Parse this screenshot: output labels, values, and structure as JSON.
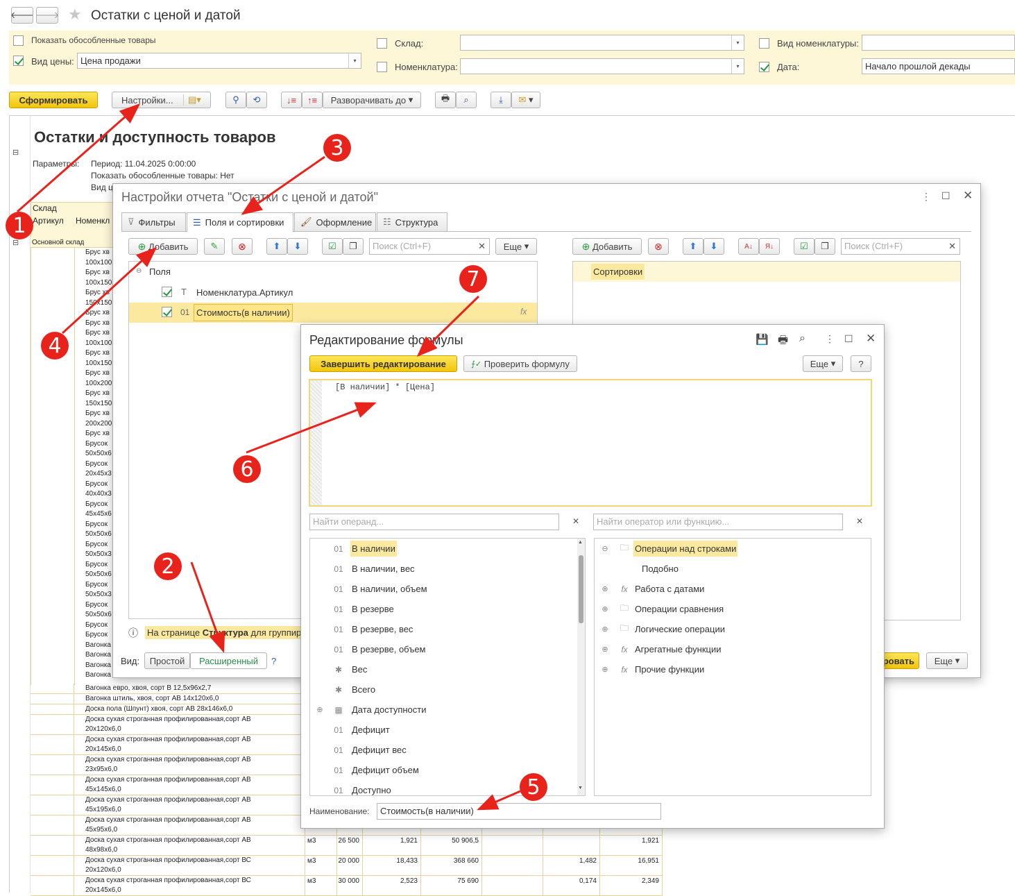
{
  "header": {
    "title": "Остатки с ценой и датой"
  },
  "params": {
    "show_separate": "Показать обособленные товары",
    "price_type_label": "Вид цены:",
    "price_type_value": "Цена продажи",
    "warehouse_label": "Склад:",
    "nomenclature_label": "Номенклатура:",
    "nom_kind_label": "Вид номенклатуры:",
    "date_label": "Дата:",
    "date_value": "Начало прошлой декады"
  },
  "toolbar": {
    "generate": "Сформировать",
    "settings": "Настройки...",
    "expand_to": "Разворачивать до"
  },
  "report": {
    "title": "Остатки и доступность товаров",
    "params_label": "Параметры:",
    "period": "Период: 11.04.2025 0:00:00",
    "show_separate": "Показать обособленные товары: Нет",
    "view_partial": "Вид ц",
    "col_warehouse": "Склад",
    "col_article": "Артикул",
    "col_nom_partial": "Номенкл",
    "group_row": "Основной склад",
    "rows_partial": [
      "Брус хв",
      "100х100",
      "Брус хв",
      "100х150",
      "Брус хв",
      "150х150",
      "Брус хв",
      "Брус хв",
      "Брус хв",
      "100х100",
      "Брус хв",
      "100х150",
      "Брус хв",
      "100х200",
      "Брус хв",
      "150х150",
      "Брус хв",
      "200х200",
      "Брус хв",
      "Брусок",
      "50х50х6",
      "Брусок",
      "20х45х3",
      "Брусок",
      "40х40х3",
      "Брусок",
      "45х45х6",
      "Брусок",
      "50х50х6",
      "Брусок",
      "50х50х3",
      "Брусок",
      "50х50х6",
      "Брусок",
      "50х50х3",
      "Брусок",
      "50х50х6",
      "Брусок",
      "Брусок",
      "Вагонка",
      "Вагонка",
      "Вагонка",
      "Вагонка"
    ],
    "rows": [
      {
        "name": "Вагонка евро, хвоя, сорт В 12,5х96х2,7"
      },
      {
        "name": "Вагонка штиль, хвоя, сорт АВ 14х120х6,0"
      },
      {
        "name": "Доска пола (Шпунт) хвоя, сорт АВ 28х146х6,0"
      },
      {
        "name": "Доска сухая строганная профилированная,сорт АВ",
        "sub": "20х120х6,0"
      },
      {
        "name": "Доска сухая строганная профилированная,сорт АВ",
        "sub": "20х145х6,0"
      },
      {
        "name": "Доска сухая строганная профилированная,сорт АВ",
        "sub": "23х95х6,0"
      },
      {
        "name": "Доска сухая строганная профилированная,сорт АВ",
        "sub": "45х145х6,0"
      },
      {
        "name": "Доска сухая строганная профилированная,сорт АВ",
        "sub": "45х195х6,0"
      },
      {
        "name": "Доска сухая строганная профилированная,сорт АВ",
        "sub": "45х95х6,0"
      },
      {
        "name": "Доска сухая строганная профилированная,сорт АВ",
        "sub": "48х98х6,0",
        "unit": "м3",
        "c1": "26 500",
        "c2": "1,921",
        "c3": "50 906,5",
        "c4": "",
        "c5": "",
        "c6": "1,921"
      },
      {
        "name": "Доска сухая строганная профилированная,сорт ВС",
        "sub": "20х120х6,0",
        "unit": "м3",
        "c1": "20 000",
        "c2": "18,433",
        "c3": "368 660",
        "c4": "",
        "c5": "1,482",
        "c6": "16,951"
      },
      {
        "name": "Доска сухая строганная профилированная,сорт ВС",
        "sub": "20х145х6,0",
        "unit": "м3",
        "c1": "30 000",
        "c2": "2,523",
        "c3": "75 690",
        "c4": "",
        "c5": "0,174",
        "c6": "2,349"
      }
    ]
  },
  "settings": {
    "title": "Настройки отчета \"Остатки с ценой и датой\"",
    "tabs": [
      "Фильтры",
      "Поля и сортировки",
      "Оформление",
      "Структура"
    ],
    "add": "Добавить",
    "search_placeholder": "Поиск (Ctrl+F)",
    "more": "Еще",
    "tree_root": "Поля",
    "fields": [
      {
        "type": "Т",
        "name": "Номенклатура.Артикул"
      },
      {
        "type": "01",
        "name": "Стоимость(в наличии)"
      }
    ],
    "sort_title": "Сортировки",
    "hint_prefix": "На странице ",
    "hint_bold": "Структура",
    "hint_suffix": " для группир",
    "view_label": "Вид:",
    "view_simple": "Простой",
    "view_advanced": "Расширенный",
    "help": "?",
    "finish_partial": "ровать"
  },
  "formula": {
    "title": "Редактирование формулы",
    "finish": "Завершить редактирование",
    "check": "Проверить формулу",
    "more": "Еще",
    "help": "?",
    "text": "[В наличии] * [Цена]",
    "operand_placeholder": "Найти операнд...",
    "operator_placeholder": "Найти оператор или функцию...",
    "operands": [
      {
        "icon": "01",
        "name": "В наличии"
      },
      {
        "icon": "01",
        "name": "В наличии, вес"
      },
      {
        "icon": "01",
        "name": "В наличии, объем"
      },
      {
        "icon": "01",
        "name": "В резерве"
      },
      {
        "icon": "01",
        "name": "В резерве, вес"
      },
      {
        "icon": "01",
        "name": "В резерве, объем"
      },
      {
        "icon": "*",
        "name": "Вес"
      },
      {
        "icon": "*",
        "name": "Всего"
      },
      {
        "icon": "cal",
        "name": "Дата доступности"
      },
      {
        "icon": "01",
        "name": "Дефицит"
      },
      {
        "icon": "01",
        "name": "Дефицит вес"
      },
      {
        "icon": "01",
        "name": "Дефицит объем"
      },
      {
        "icon": "01",
        "name": "Доступно"
      }
    ],
    "operators": [
      {
        "icon": "folder",
        "name": "Операции над строками",
        "expand": "⊖"
      },
      {
        "icon": "",
        "name": "Подобно",
        "expand": ""
      },
      {
        "icon": "fx",
        "name": "Работа с датами",
        "expand": "⊕"
      },
      {
        "icon": "folder",
        "name": "Операции сравнения",
        "expand": "⊕"
      },
      {
        "icon": "folder",
        "name": "Логические операции",
        "expand": "⊕"
      },
      {
        "icon": "fx",
        "name": "Агрегатные функции",
        "expand": "⊕"
      },
      {
        "icon": "fx",
        "name": "Прочие функции",
        "expand": "⊕"
      }
    ],
    "name_label": "Наименование:",
    "name_value": "Стоимость(в наличии)"
  },
  "markers": [
    "1",
    "2",
    "3",
    "4",
    "5",
    "6",
    "7"
  ],
  "colors": {
    "accent_yellow": "#f5d218",
    "highlight": "#fbe9a0",
    "param_bg": "#fdf6d7",
    "marker": "#e8231b"
  }
}
